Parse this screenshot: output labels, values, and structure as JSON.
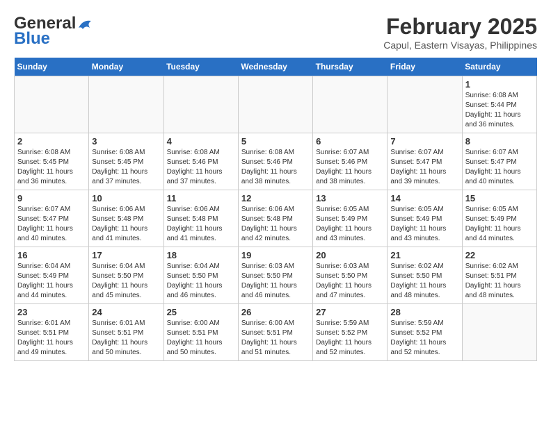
{
  "header": {
    "logo_line1": "General",
    "logo_line2": "Blue",
    "month": "February 2025",
    "location": "Capul, Eastern Visayas, Philippines"
  },
  "days_of_week": [
    "Sunday",
    "Monday",
    "Tuesday",
    "Wednesday",
    "Thursday",
    "Friday",
    "Saturday"
  ],
  "weeks": [
    [
      {
        "day": "",
        "info": ""
      },
      {
        "day": "",
        "info": ""
      },
      {
        "day": "",
        "info": ""
      },
      {
        "day": "",
        "info": ""
      },
      {
        "day": "",
        "info": ""
      },
      {
        "day": "",
        "info": ""
      },
      {
        "day": "1",
        "info": "Sunrise: 6:08 AM\nSunset: 5:44 PM\nDaylight: 11 hours\nand 36 minutes."
      }
    ],
    [
      {
        "day": "2",
        "info": "Sunrise: 6:08 AM\nSunset: 5:45 PM\nDaylight: 11 hours\nand 36 minutes."
      },
      {
        "day": "3",
        "info": "Sunrise: 6:08 AM\nSunset: 5:45 PM\nDaylight: 11 hours\nand 37 minutes."
      },
      {
        "day": "4",
        "info": "Sunrise: 6:08 AM\nSunset: 5:46 PM\nDaylight: 11 hours\nand 37 minutes."
      },
      {
        "day": "5",
        "info": "Sunrise: 6:08 AM\nSunset: 5:46 PM\nDaylight: 11 hours\nand 38 minutes."
      },
      {
        "day": "6",
        "info": "Sunrise: 6:07 AM\nSunset: 5:46 PM\nDaylight: 11 hours\nand 38 minutes."
      },
      {
        "day": "7",
        "info": "Sunrise: 6:07 AM\nSunset: 5:47 PM\nDaylight: 11 hours\nand 39 minutes."
      },
      {
        "day": "8",
        "info": "Sunrise: 6:07 AM\nSunset: 5:47 PM\nDaylight: 11 hours\nand 40 minutes."
      }
    ],
    [
      {
        "day": "9",
        "info": "Sunrise: 6:07 AM\nSunset: 5:47 PM\nDaylight: 11 hours\nand 40 minutes."
      },
      {
        "day": "10",
        "info": "Sunrise: 6:06 AM\nSunset: 5:48 PM\nDaylight: 11 hours\nand 41 minutes."
      },
      {
        "day": "11",
        "info": "Sunrise: 6:06 AM\nSunset: 5:48 PM\nDaylight: 11 hours\nand 41 minutes."
      },
      {
        "day": "12",
        "info": "Sunrise: 6:06 AM\nSunset: 5:48 PM\nDaylight: 11 hours\nand 42 minutes."
      },
      {
        "day": "13",
        "info": "Sunrise: 6:05 AM\nSunset: 5:49 PM\nDaylight: 11 hours\nand 43 minutes."
      },
      {
        "day": "14",
        "info": "Sunrise: 6:05 AM\nSunset: 5:49 PM\nDaylight: 11 hours\nand 43 minutes."
      },
      {
        "day": "15",
        "info": "Sunrise: 6:05 AM\nSunset: 5:49 PM\nDaylight: 11 hours\nand 44 minutes."
      }
    ],
    [
      {
        "day": "16",
        "info": "Sunrise: 6:04 AM\nSunset: 5:49 PM\nDaylight: 11 hours\nand 44 minutes."
      },
      {
        "day": "17",
        "info": "Sunrise: 6:04 AM\nSunset: 5:50 PM\nDaylight: 11 hours\nand 45 minutes."
      },
      {
        "day": "18",
        "info": "Sunrise: 6:04 AM\nSunset: 5:50 PM\nDaylight: 11 hours\nand 46 minutes."
      },
      {
        "day": "19",
        "info": "Sunrise: 6:03 AM\nSunset: 5:50 PM\nDaylight: 11 hours\nand 46 minutes."
      },
      {
        "day": "20",
        "info": "Sunrise: 6:03 AM\nSunset: 5:50 PM\nDaylight: 11 hours\nand 47 minutes."
      },
      {
        "day": "21",
        "info": "Sunrise: 6:02 AM\nSunset: 5:50 PM\nDaylight: 11 hours\nand 48 minutes."
      },
      {
        "day": "22",
        "info": "Sunrise: 6:02 AM\nSunset: 5:51 PM\nDaylight: 11 hours\nand 48 minutes."
      }
    ],
    [
      {
        "day": "23",
        "info": "Sunrise: 6:01 AM\nSunset: 5:51 PM\nDaylight: 11 hours\nand 49 minutes."
      },
      {
        "day": "24",
        "info": "Sunrise: 6:01 AM\nSunset: 5:51 PM\nDaylight: 11 hours\nand 50 minutes."
      },
      {
        "day": "25",
        "info": "Sunrise: 6:00 AM\nSunset: 5:51 PM\nDaylight: 11 hours\nand 50 minutes."
      },
      {
        "day": "26",
        "info": "Sunrise: 6:00 AM\nSunset: 5:51 PM\nDaylight: 11 hours\nand 51 minutes."
      },
      {
        "day": "27",
        "info": "Sunrise: 5:59 AM\nSunset: 5:52 PM\nDaylight: 11 hours\nand 52 minutes."
      },
      {
        "day": "28",
        "info": "Sunrise: 5:59 AM\nSunset: 5:52 PM\nDaylight: 11 hours\nand 52 minutes."
      },
      {
        "day": "",
        "info": ""
      }
    ]
  ]
}
